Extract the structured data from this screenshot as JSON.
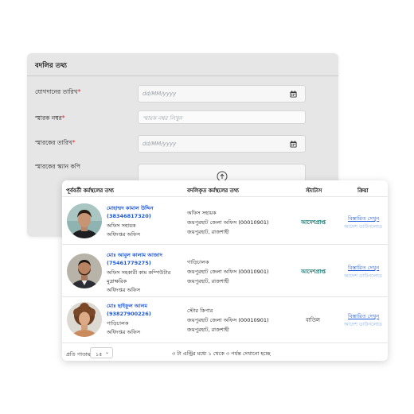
{
  "form": {
    "title": "বদলির তথ্য",
    "join_date_label": "যোগদানের তারিখ",
    "join_date_placeholder": "dd/MM/yyyy",
    "memo_no_label": "স্মারক নম্বর",
    "memo_no_placeholder": "স্মারক নম্বর লিখুন",
    "memo_date_label": "স্মারকের তারিখ",
    "memo_date_placeholder": "dd/MM/yyyy",
    "memo_scan_label": "স্মারকের স্ক্যান কপি",
    "required_mark": "*"
  },
  "table": {
    "headers": {
      "prev_workplace": "পূর্ববর্তী কর্মস্থলের তথ্য",
      "transfer_workplace": "বদলিকৃত কর্মস্থলের তথ্য",
      "status": "স্ট্যাটাস",
      "action": "ক্রিয়া"
    },
    "rows": [
      {
        "name": "মোহাম্মদ কামাল উদ্দিন",
        "id": "(38346817320)",
        "designation": "অফিস সহায়ক",
        "office": "অধিদপ্তর অফিস",
        "office_extra": "",
        "new_designation": "অফিস সহায়ক",
        "new_office": "জয়পুরহাট জেলা অফিস (00010901)",
        "new_location": "জয়পুরহাট, রাজশাহী",
        "status": "আদেশপ্রাপ্ত",
        "action_details": "বিস্তারিত দেখুন",
        "action_download": "আদেশ ডাউনলোড"
      },
      {
        "name": "মোঃ আবুল কালাম আজাদ",
        "id": "(75461779275)",
        "designation": "অফিস সহকারী কাম কম্পিউটার",
        "office": "মুদ্রাক্ষরিক",
        "office_extra": "অধিদপ্তর অফিস",
        "new_designation": "গাড়িচালক",
        "new_office": "জয়পুরহাট জেলা অফিস (00010901)",
        "new_location": "জয়পুরহাট, রাজশাহী",
        "status": "আদেশপ্রাপ্ত",
        "action_details": "বিস্তারিত দেখুন",
        "action_download": "আদেশ ডাউনলোড"
      },
      {
        "name": "মোঃ ছাইফুল আলম",
        "id": "(93827900226)",
        "designation": "গাড়িচালক",
        "office": "অধিদপ্তর অফিস",
        "office_extra": "",
        "new_designation": "স্টোর কিপার",
        "new_office": "জয়পুরহাট জেলা অফিস (00010901)",
        "new_location": "জয়পুরহাট, রাজশাহী",
        "status": "বাতিল",
        "action_details": "বিস্তারিত দেখুন",
        "action_download": "আদেশ ডাউনলোড"
      }
    ],
    "footer": {
      "per_page_label": "প্রতি পাতায়",
      "per_page_value": "১৫",
      "pagination_text": "৩ টা এন্ট্রির মধ্যে ১ থেকে ৩ পর্যন্ত দেখানো হচ্ছে"
    }
  },
  "colors": {
    "link": "#1a56db",
    "status_approved": "#0f766e",
    "required": "#e02424"
  }
}
